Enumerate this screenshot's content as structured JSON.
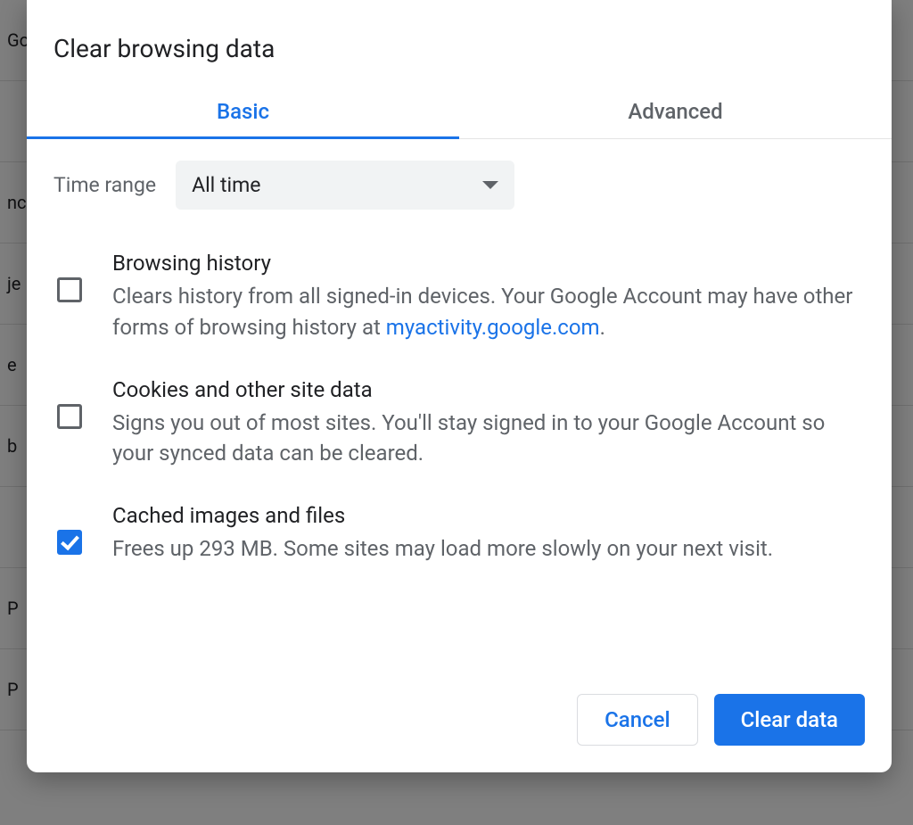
{
  "background": {
    "rows": [
      "Go",
      "",
      "nc",
      "je",
      "e",
      " b",
      "",
      "P",
      "P"
    ]
  },
  "dialog": {
    "title": "Clear browsing data",
    "tabs": [
      {
        "label": "Basic",
        "active": true
      },
      {
        "label": "Advanced",
        "active": false
      }
    ],
    "time_range_label": "Time range",
    "time_range_value": "All time",
    "options": [
      {
        "title": "Browsing history",
        "description_pre": "Clears history from all signed-in devices. Your Google Account may have other forms of browsing history at ",
        "link_text": "myactivity.google.com",
        "description_post": ".",
        "checked": false
      },
      {
        "title": "Cookies and other site data",
        "description_pre": "Signs you out of most sites. You'll stay signed in to your Google Account so your synced data can be cleared.",
        "link_text": "",
        "description_post": "",
        "checked": false
      },
      {
        "title": "Cached images and files",
        "description_pre": "Frees up 293 MB. Some sites may load more slowly on your next visit.",
        "link_text": "",
        "description_post": "",
        "checked": true
      }
    ],
    "buttons": {
      "cancel": "Cancel",
      "confirm": "Clear data"
    }
  }
}
